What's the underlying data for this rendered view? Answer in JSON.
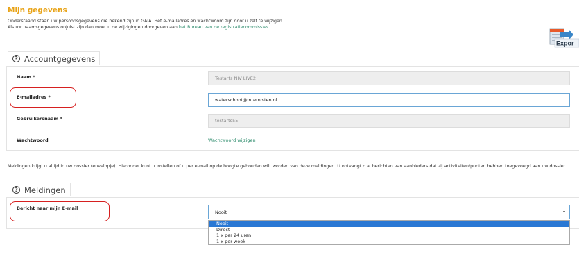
{
  "page": {
    "title": "Mijn gegevens",
    "intro_line1": "Onderstaand staan uw persoonsgegevens die bekend zijn in GAIA. Het e-mailadres en wachtwoord zijn door u zelf te wijzigen.",
    "intro_line2_prefix": "Als uw naamsgegevens onjuist zijn dan moet u de wijzigingen doorgeven aan ",
    "intro_link": "het Bureau van de registratiecommissies",
    "intro_line2_suffix": ".",
    "export_label": "Expor"
  },
  "account": {
    "heading": "Accountgegevens",
    "help_glyph": "?",
    "fields": [
      {
        "label": "Naam *",
        "value": "Testarts NIV LIVE2"
      },
      {
        "label": "E-mailadres *",
        "value": "waterschoot@internisten.nl"
      },
      {
        "label": "Gebruikersnaam *",
        "value": "testarts55"
      },
      {
        "label": "Wachtwoord",
        "value": "Wachtwoord wijzigen"
      }
    ]
  },
  "notifications": {
    "description": "Meldingen krijgt u altijd in uw dossier (envelopje). Hieronder kunt u instellen of u per e-mail op de hoogte gehouden wilt worden van deze meldingen. U ontvangt o.a. berichten van aanbieders dat zij activiteiten/punten hebben toegevoegd aan uw dossier.",
    "heading": "Meldingen",
    "help_glyph": "?",
    "email_label": "Bericht naar mijn E-mail",
    "selected": "Nooit",
    "caret": "▾",
    "options": [
      "Nooit",
      "Direct",
      "1 x per 24 uren",
      "1 x per week"
    ]
  },
  "colors": {
    "title": "#e8a317",
    "link": "#2a8a6a",
    "highlight_mark": "#d62020",
    "selected_option": "#2a78d4"
  }
}
